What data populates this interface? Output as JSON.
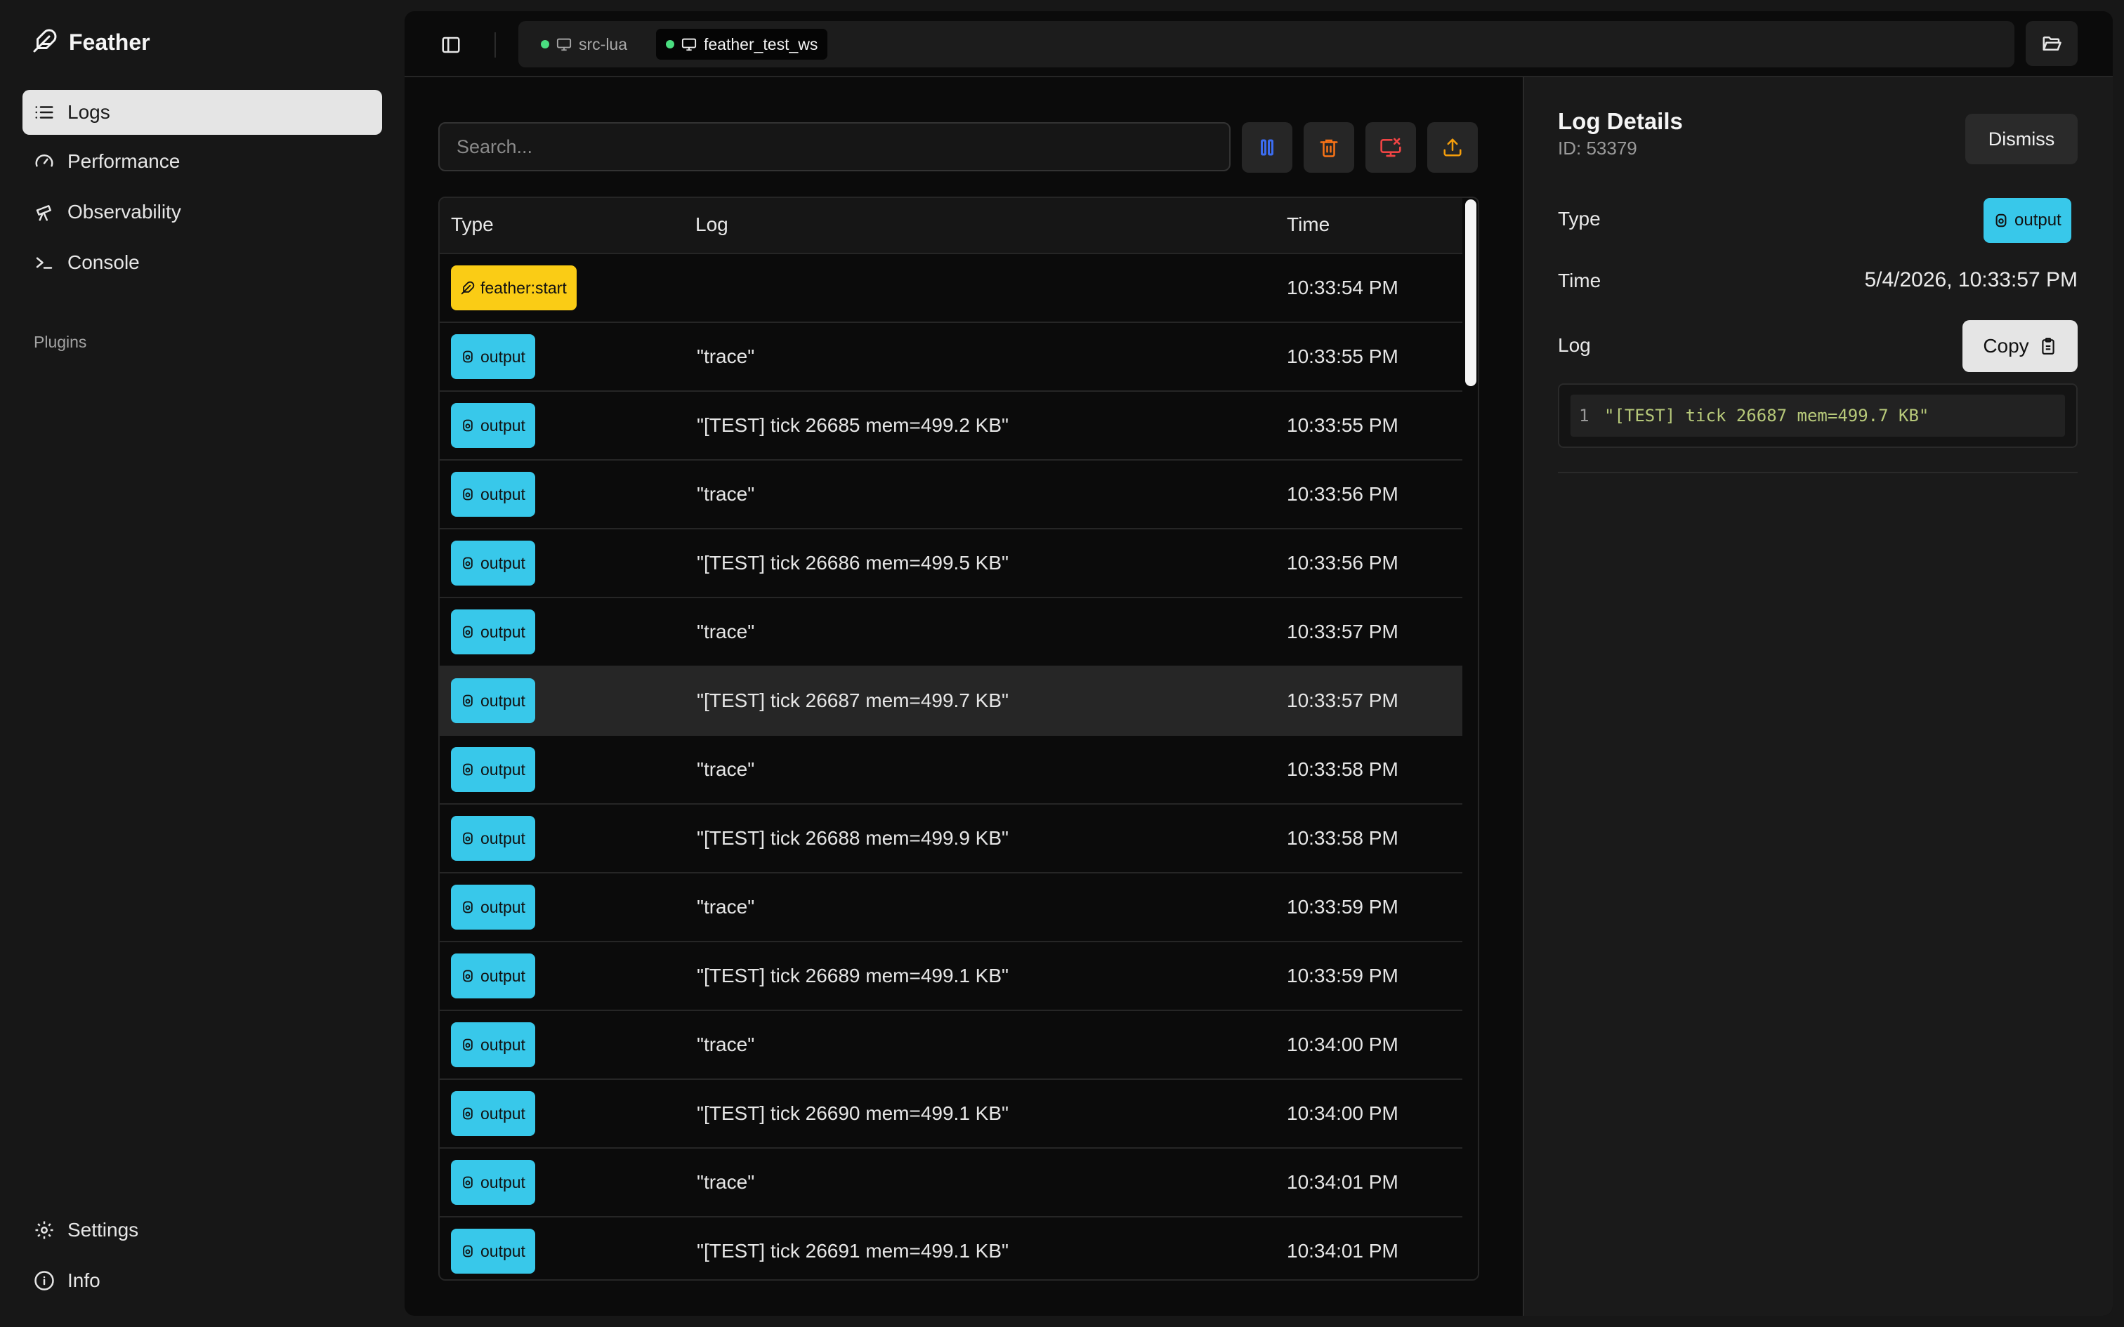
{
  "app": {
    "name": "Feather"
  },
  "sidebar": {
    "items": [
      {
        "label": "Logs"
      },
      {
        "label": "Performance"
      },
      {
        "label": "Observability"
      },
      {
        "label": "Console"
      }
    ],
    "plugins_label": "Plugins",
    "bottom": [
      {
        "label": "Settings"
      },
      {
        "label": "Info"
      }
    ]
  },
  "tabs": [
    {
      "label": "src-lua",
      "status": "connected"
    },
    {
      "label": "feather_test_ws",
      "status": "connected",
      "active": true
    }
  ],
  "search": {
    "placeholder": "Search...",
    "value": ""
  },
  "toolbar": [
    {
      "icon": "pause-icon"
    },
    {
      "icon": "trash-icon"
    },
    {
      "icon": "screen-close-icon"
    },
    {
      "icon": "upload-icon"
    }
  ],
  "table": {
    "headers": {
      "type": "Type",
      "log": "Log",
      "time": "Time"
    },
    "rows": [
      {
        "type": "feather:start",
        "log": "",
        "time": "10:33:54 PM"
      },
      {
        "type": "output",
        "log": "\"trace\"",
        "time": "10:33:55 PM"
      },
      {
        "type": "output",
        "log": "\"[TEST] tick 26685 mem=499.2 KB\"",
        "time": "10:33:55 PM"
      },
      {
        "type": "output",
        "log": "\"trace\"",
        "time": "10:33:56 PM"
      },
      {
        "type": "output",
        "log": "\"[TEST] tick 26686 mem=499.5 KB\"",
        "time": "10:33:56 PM"
      },
      {
        "type": "output",
        "log": "\"trace\"",
        "time": "10:33:57 PM"
      },
      {
        "type": "output",
        "log": "\"[TEST] tick 26687 mem=499.7 KB\"",
        "time": "10:33:57 PM",
        "selected": true
      },
      {
        "type": "output",
        "log": "\"trace\"",
        "time": "10:33:58 PM"
      },
      {
        "type": "output",
        "log": "\"[TEST] tick 26688 mem=499.9 KB\"",
        "time": "10:33:58 PM"
      },
      {
        "type": "output",
        "log": "\"trace\"",
        "time": "10:33:59 PM"
      },
      {
        "type": "output",
        "log": "\"[TEST] tick 26689 mem=499.1 KB\"",
        "time": "10:33:59 PM"
      },
      {
        "type": "output",
        "log": "\"trace\"",
        "time": "10:34:00 PM"
      },
      {
        "type": "output",
        "log": "\"[TEST] tick 26690 mem=499.1 KB\"",
        "time": "10:34:00 PM"
      },
      {
        "type": "output",
        "log": "\"trace\"",
        "time": "10:34:01 PM"
      },
      {
        "type": "output",
        "log": "\"[TEST] tick 26691 mem=499.1 KB\"",
        "time": "10:34:01 PM"
      }
    ]
  },
  "details": {
    "title": "Log Details",
    "id_text": "ID: 53379",
    "dismiss_label": "Dismiss",
    "type_label": "Type",
    "type_value": "output",
    "time_label": "Time",
    "time_value": "5/4/2026, 10:33:57 PM",
    "log_label": "Log",
    "copy_label": "Copy",
    "code_line_number": "1",
    "code_text": "\"[TEST] tick 26687 mem=499.7 KB\""
  },
  "colors": {
    "output_badge": "#38c8ea",
    "start_badge": "#facc15",
    "status_dot": "#4ade80",
    "pause": "#3b6cf0",
    "trash": "#f97316",
    "screen_close": "#ef4444",
    "upload": "#f59e0b"
  }
}
